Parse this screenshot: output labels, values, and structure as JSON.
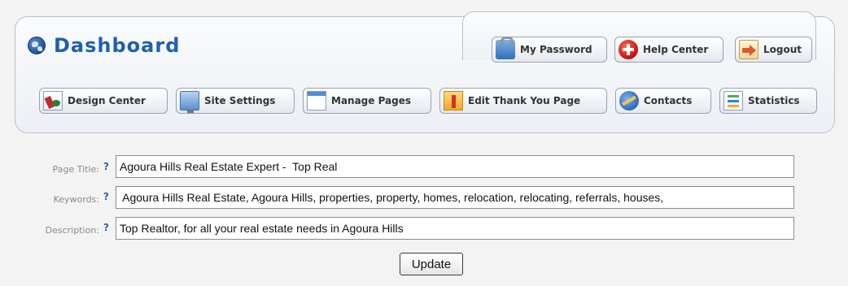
{
  "header": {
    "title": "Dashboard",
    "icon": "globe-icon"
  },
  "account_menu": [
    {
      "label": "My Password",
      "icon": "lock-icon"
    },
    {
      "label": "Help Center",
      "icon": "help-icon"
    },
    {
      "label": "Logout",
      "icon": "logout-icon"
    }
  ],
  "nav": [
    {
      "label": "Design Center",
      "icon": "design-icon"
    },
    {
      "label": "Site Settings",
      "icon": "monitor-icon"
    },
    {
      "label": "Manage Pages",
      "icon": "page-icon"
    },
    {
      "label": "Edit Thank You Page",
      "icon": "folder-bookmark-icon"
    },
    {
      "label": "Contacts",
      "icon": "contacts-icon"
    },
    {
      "label": "Statistics",
      "icon": "statistics-icon"
    }
  ],
  "form": {
    "help_marker": "?",
    "page_title": {
      "label": "Page Title:",
      "value": "Agoura Hills Real Estate Expert -  Top Real"
    },
    "keywords": {
      "label": "Keywords:",
      "value": " Agoura Hills Real Estate, Agoura Hills, properties, property, homes, relocation, relocating, referrals, houses,"
    },
    "description": {
      "label": "Description:",
      "value": "Top Realtor, for all your real estate needs in Agoura Hills"
    },
    "update_label": "Update"
  },
  "colors": {
    "title_blue": "#1f5fb3",
    "help_marker_blue": "#2d5fa8",
    "label_gray": "#8a8a8a"
  }
}
